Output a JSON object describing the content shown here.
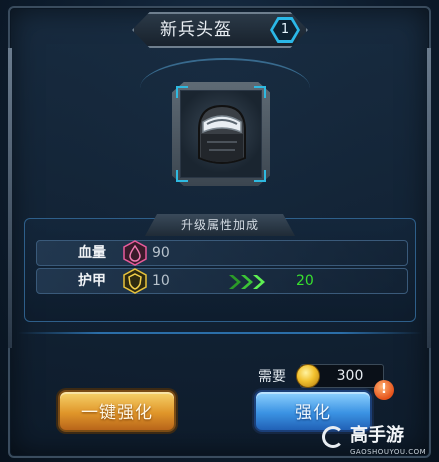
{
  "header": {
    "title": "新兵头盔",
    "level": "1"
  },
  "item": {
    "icon": "helmet-icon"
  },
  "attributes": {
    "header": "升级属性加成",
    "rows": [
      {
        "label": "血量",
        "icon": "blood-drop-icon",
        "value": "90"
      },
      {
        "label": "护甲",
        "icon": "shield-icon",
        "value": "10",
        "next": "20"
      }
    ]
  },
  "cost": {
    "label": "需要",
    "icon": "gold-coin-icon",
    "value": "300"
  },
  "buttons": {
    "one_click": "一键强化",
    "strengthen": "强化",
    "alert": "!"
  },
  "watermark": {
    "name": "高手游",
    "url": "GAOSHOUYOU.COM"
  },
  "colors": {
    "accent_cyan": "#2bb8e8",
    "upgrade_green": "#38e02e",
    "gold_button": "#e0962a",
    "blue_button": "#3b93e3"
  }
}
